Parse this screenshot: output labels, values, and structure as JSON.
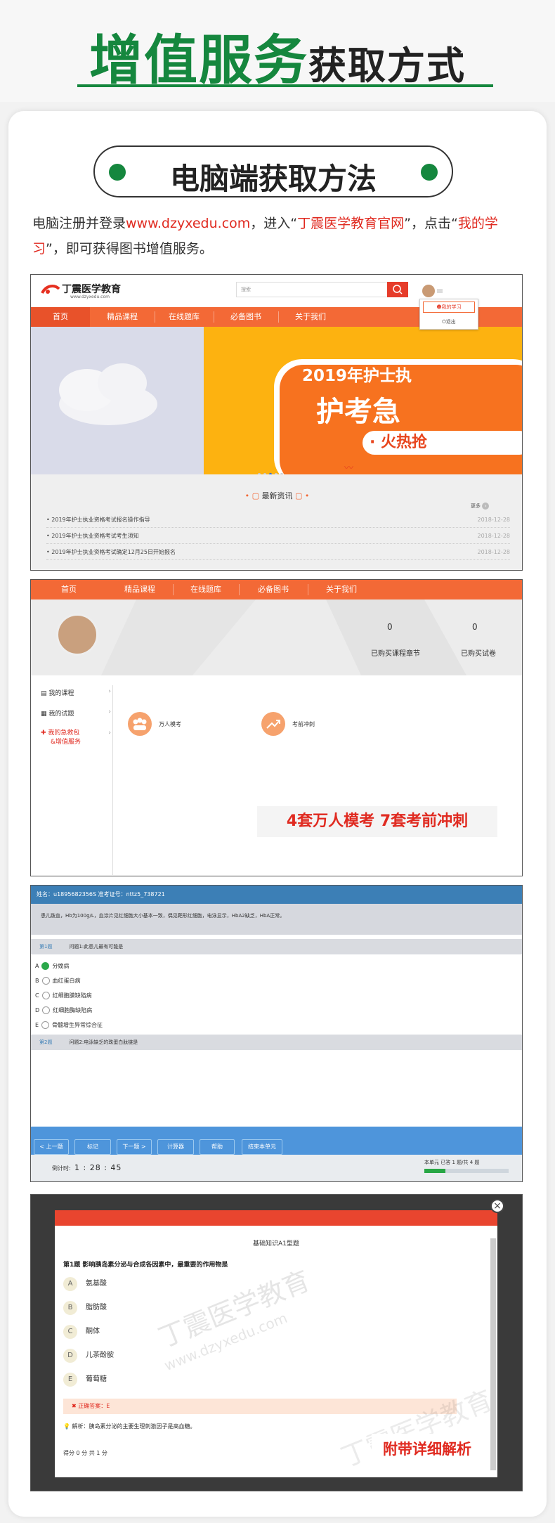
{
  "header": {
    "title_green": "增值服务",
    "title_black": "获取方式"
  },
  "section": {
    "pill_title": "电脑端获取方法"
  },
  "intro": {
    "p1": "电脑注册并登录",
    "url": "www.dzyxedu.com",
    "p2": "，进入“",
    "site": "丁震医学教育官网",
    "p3": "”，点击“",
    "link": "我的学习",
    "p4": "”，即可获得图书增值服务。"
  },
  "shot1": {
    "logo": "丁震医学教育",
    "logo_url": "www.dzyxedu.com",
    "search_placeholder": "搜索",
    "dropdown": {
      "item1": "我的学习",
      "item2": "退出"
    },
    "nav": [
      "首页",
      "精品课程",
      "在线题库",
      "必备图书",
      "关于我们"
    ],
    "banner": {
      "line1": "2019年护士执",
      "line2": "护考急",
      "line3": "· 火热抢"
    },
    "news_title": "最新资讯",
    "more": "更多",
    "news": [
      {
        "title": "2019年护士执业资格考试报名操作指导",
        "date": "2018-12-28"
      },
      {
        "title": "2019年护士执业资格考试考生须知",
        "date": "2018-12-28"
      },
      {
        "title": "2019年护士执业资格考试确定12月25日开始报名",
        "date": "2018-12-28"
      }
    ]
  },
  "shot2": {
    "nav": [
      "首页",
      "精品课程",
      "在线题库",
      "必备图书",
      "关于我们"
    ],
    "stat1": {
      "value": "0",
      "label": "已购买课程章节"
    },
    "stat2": {
      "value": "0",
      "label": "已购买试卷"
    },
    "menu": [
      "我的课程",
      "我的试题",
      "我的急救包",
      "&增值服务"
    ],
    "tile1": "万人模考",
    "tile2": "考前冲刺",
    "caption": "4套万人模考  7套考前冲刺"
  },
  "shot3": {
    "top": "姓名：u1895682356S    准考证号：nttz5_738721",
    "stem": "患儿跛血，Hb为100g/L，血涂片见红细胞大小基本一致，偶见靶形红细胞，电泳显示，HbA2缺乏，HbA正常。",
    "q1_no": "第1题",
    "q1_text": "问题1:此患儿最有可能是",
    "options": [
      "A",
      "B",
      "C",
      "D",
      "E"
    ],
    "option_texts": [
      "分娩病",
      "血红蛋白病",
      "红细胞膜缺陷病",
      "红细胞酶缺陷病",
      "骨髓增生异常综合征"
    ],
    "q2_no": "第2题",
    "q2_text": "问题2:电泳缺乏的珠蛋白肽链是",
    "buttons": [
      "< 上一题",
      "标记",
      "下一题 >",
      "计算器",
      "帮助",
      "结束本单元"
    ],
    "timer_label": "倒计时:",
    "timer": "1 : 28 : 45",
    "progress": "本单元 已答 1 题/共 4 题",
    "progress_fraction": 0.25
  },
  "shot4": {
    "title": "基础知识A1型题",
    "q_no": "第1题",
    "q_text": "影响胰岛素分泌与合成各因素中，最重要的作用物是",
    "options": [
      "A",
      "B",
      "C",
      "D",
      "E"
    ],
    "option_texts": [
      "氨基酸",
      "脂肪酸",
      "酮体",
      "儿茶酚胺",
      "葡萄糖"
    ],
    "answer_label": "正确答案：",
    "answer": "E",
    "explain_label": "解析：",
    "explain": "胰岛素分泌的主要生理刺激因子是高血糖。",
    "score": "得分 0 分  共 1 分",
    "caption": "附带详细解析",
    "watermark_cn": "丁震医学教育",
    "watermark_url": "www.dzyxedu.com",
    "close": "×"
  }
}
